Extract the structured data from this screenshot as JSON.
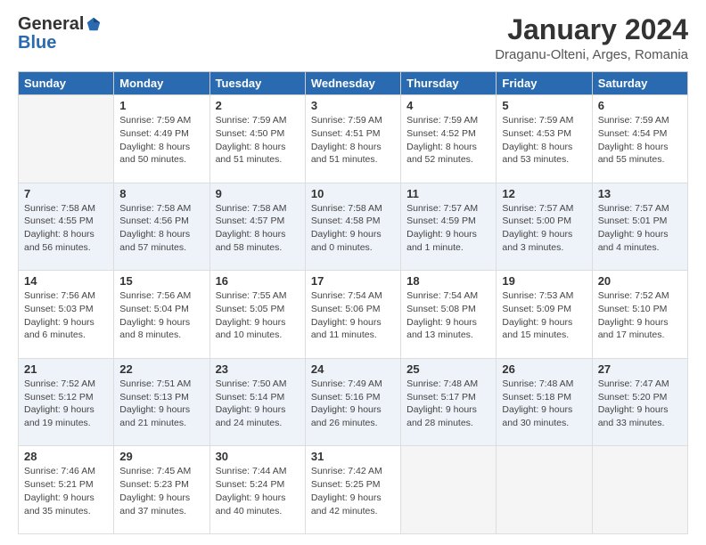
{
  "header": {
    "logo": {
      "general": "General",
      "blue": "Blue"
    },
    "title": "January 2024",
    "location": "Draganu-Olteni, Arges, Romania"
  },
  "days_of_week": [
    "Sunday",
    "Monday",
    "Tuesday",
    "Wednesday",
    "Thursday",
    "Friday",
    "Saturday"
  ],
  "weeks": [
    [
      {
        "day": "",
        "empty": true
      },
      {
        "day": "1",
        "sunrise": "Sunrise: 7:59 AM",
        "sunset": "Sunset: 4:49 PM",
        "daylight": "Daylight: 8 hours and 50 minutes."
      },
      {
        "day": "2",
        "sunrise": "Sunrise: 7:59 AM",
        "sunset": "Sunset: 4:50 PM",
        "daylight": "Daylight: 8 hours and 51 minutes."
      },
      {
        "day": "3",
        "sunrise": "Sunrise: 7:59 AM",
        "sunset": "Sunset: 4:51 PM",
        "daylight": "Daylight: 8 hours and 51 minutes."
      },
      {
        "day": "4",
        "sunrise": "Sunrise: 7:59 AM",
        "sunset": "Sunset: 4:52 PM",
        "daylight": "Daylight: 8 hours and 52 minutes."
      },
      {
        "day": "5",
        "sunrise": "Sunrise: 7:59 AM",
        "sunset": "Sunset: 4:53 PM",
        "daylight": "Daylight: 8 hours and 53 minutes."
      },
      {
        "day": "6",
        "sunrise": "Sunrise: 7:59 AM",
        "sunset": "Sunset: 4:54 PM",
        "daylight": "Daylight: 8 hours and 55 minutes."
      }
    ],
    [
      {
        "day": "7",
        "sunrise": "Sunrise: 7:58 AM",
        "sunset": "Sunset: 4:55 PM",
        "daylight": "Daylight: 8 hours and 56 minutes."
      },
      {
        "day": "8",
        "sunrise": "Sunrise: 7:58 AM",
        "sunset": "Sunset: 4:56 PM",
        "daylight": "Daylight: 8 hours and 57 minutes."
      },
      {
        "day": "9",
        "sunrise": "Sunrise: 7:58 AM",
        "sunset": "Sunset: 4:57 PM",
        "daylight": "Daylight: 8 hours and 58 minutes."
      },
      {
        "day": "10",
        "sunrise": "Sunrise: 7:58 AM",
        "sunset": "Sunset: 4:58 PM",
        "daylight": "Daylight: 9 hours and 0 minutes."
      },
      {
        "day": "11",
        "sunrise": "Sunrise: 7:57 AM",
        "sunset": "Sunset: 4:59 PM",
        "daylight": "Daylight: 9 hours and 1 minute."
      },
      {
        "day": "12",
        "sunrise": "Sunrise: 7:57 AM",
        "sunset": "Sunset: 5:00 PM",
        "daylight": "Daylight: 9 hours and 3 minutes."
      },
      {
        "day": "13",
        "sunrise": "Sunrise: 7:57 AM",
        "sunset": "Sunset: 5:01 PM",
        "daylight": "Daylight: 9 hours and 4 minutes."
      }
    ],
    [
      {
        "day": "14",
        "sunrise": "Sunrise: 7:56 AM",
        "sunset": "Sunset: 5:03 PM",
        "daylight": "Daylight: 9 hours and 6 minutes."
      },
      {
        "day": "15",
        "sunrise": "Sunrise: 7:56 AM",
        "sunset": "Sunset: 5:04 PM",
        "daylight": "Daylight: 9 hours and 8 minutes."
      },
      {
        "day": "16",
        "sunrise": "Sunrise: 7:55 AM",
        "sunset": "Sunset: 5:05 PM",
        "daylight": "Daylight: 9 hours and 10 minutes."
      },
      {
        "day": "17",
        "sunrise": "Sunrise: 7:54 AM",
        "sunset": "Sunset: 5:06 PM",
        "daylight": "Daylight: 9 hours and 11 minutes."
      },
      {
        "day": "18",
        "sunrise": "Sunrise: 7:54 AM",
        "sunset": "Sunset: 5:08 PM",
        "daylight": "Daylight: 9 hours and 13 minutes."
      },
      {
        "day": "19",
        "sunrise": "Sunrise: 7:53 AM",
        "sunset": "Sunset: 5:09 PM",
        "daylight": "Daylight: 9 hours and 15 minutes."
      },
      {
        "day": "20",
        "sunrise": "Sunrise: 7:52 AM",
        "sunset": "Sunset: 5:10 PM",
        "daylight": "Daylight: 9 hours and 17 minutes."
      }
    ],
    [
      {
        "day": "21",
        "sunrise": "Sunrise: 7:52 AM",
        "sunset": "Sunset: 5:12 PM",
        "daylight": "Daylight: 9 hours and 19 minutes."
      },
      {
        "day": "22",
        "sunrise": "Sunrise: 7:51 AM",
        "sunset": "Sunset: 5:13 PM",
        "daylight": "Daylight: 9 hours and 21 minutes."
      },
      {
        "day": "23",
        "sunrise": "Sunrise: 7:50 AM",
        "sunset": "Sunset: 5:14 PM",
        "daylight": "Daylight: 9 hours and 24 minutes."
      },
      {
        "day": "24",
        "sunrise": "Sunrise: 7:49 AM",
        "sunset": "Sunset: 5:16 PM",
        "daylight": "Daylight: 9 hours and 26 minutes."
      },
      {
        "day": "25",
        "sunrise": "Sunrise: 7:48 AM",
        "sunset": "Sunset: 5:17 PM",
        "daylight": "Daylight: 9 hours and 28 minutes."
      },
      {
        "day": "26",
        "sunrise": "Sunrise: 7:48 AM",
        "sunset": "Sunset: 5:18 PM",
        "daylight": "Daylight: 9 hours and 30 minutes."
      },
      {
        "day": "27",
        "sunrise": "Sunrise: 7:47 AM",
        "sunset": "Sunset: 5:20 PM",
        "daylight": "Daylight: 9 hours and 33 minutes."
      }
    ],
    [
      {
        "day": "28",
        "sunrise": "Sunrise: 7:46 AM",
        "sunset": "Sunset: 5:21 PM",
        "daylight": "Daylight: 9 hours and 35 minutes."
      },
      {
        "day": "29",
        "sunrise": "Sunrise: 7:45 AM",
        "sunset": "Sunset: 5:23 PM",
        "daylight": "Daylight: 9 hours and 37 minutes."
      },
      {
        "day": "30",
        "sunrise": "Sunrise: 7:44 AM",
        "sunset": "Sunset: 5:24 PM",
        "daylight": "Daylight: 9 hours and 40 minutes."
      },
      {
        "day": "31",
        "sunrise": "Sunrise: 7:42 AM",
        "sunset": "Sunset: 5:25 PM",
        "daylight": "Daylight: 9 hours and 42 minutes."
      },
      {
        "day": "",
        "empty": true
      },
      {
        "day": "",
        "empty": true
      },
      {
        "day": "",
        "empty": true
      }
    ]
  ]
}
